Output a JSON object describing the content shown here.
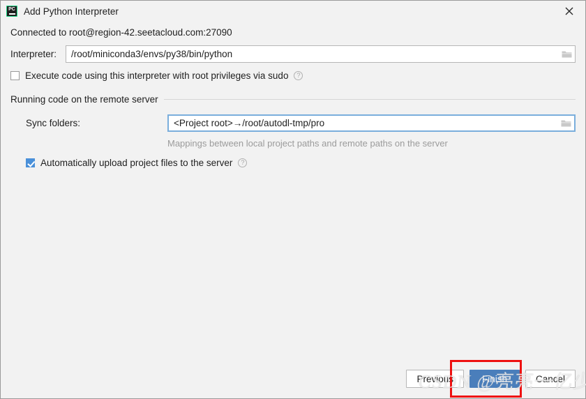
{
  "window": {
    "title": "Add Python Interpreter",
    "app_icon": "pycharm-icon",
    "icon_text": "PC",
    "close_icon": "close-icon"
  },
  "connection": {
    "status_text": "Connected to root@region-42.seetacloud.com:27090"
  },
  "interpreter": {
    "label": "Interpreter:",
    "value": "/root/miniconda3/envs/py38/bin/python",
    "browse_icon": "folder-icon"
  },
  "sudo": {
    "label": "Execute code using this interpreter with root privileges via sudo",
    "checked": false,
    "help_icon": "help-icon",
    "help_glyph": "?"
  },
  "remote_group": {
    "title": "Running code on the remote server"
  },
  "sync": {
    "label": "Sync folders:",
    "value": "<Project root>→/root/autodl-tmp/pro",
    "browse_icon": "folder-icon",
    "hint": "Mappings between local project paths and remote paths on the server"
  },
  "auto_upload": {
    "label": "Automatically upload project files to the server",
    "checked": true,
    "help_icon": "help-icon",
    "help_glyph": "?"
  },
  "footer": {
    "previous_label": "Previous",
    "finish_label": "Finish",
    "cancel_label": "Cancel"
  },
  "annotation": {
    "watermark_text": "CSDN @亮亮一亿少女梦",
    "highlight_color": "#ee1111",
    "primary_button_color": "#4a7ebb",
    "focus_border_color": "#7aaedc",
    "checkbox_color": "#4a90d9"
  }
}
